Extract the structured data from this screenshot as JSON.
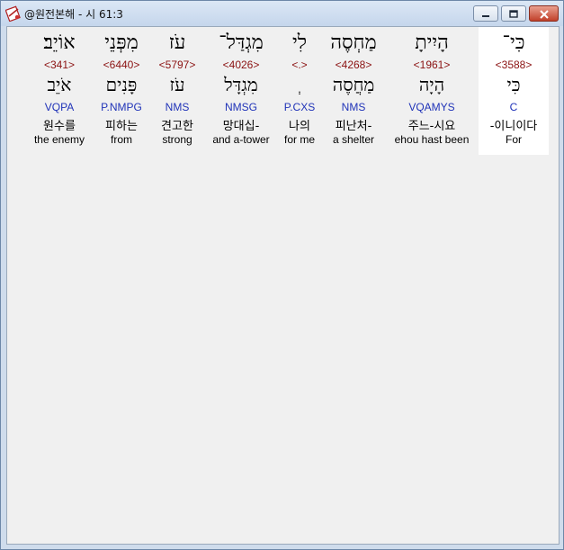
{
  "window": {
    "title": "@원전본해 - 시 61:3",
    "app_icon": "bible-book-icon",
    "controls": {
      "minimize": "minimize-icon",
      "maximize": "maximize-icon",
      "close": "close-icon"
    }
  },
  "words": [
    {
      "hebrew": "כִּי־",
      "strong": "<3588>",
      "lemma": "כִּי",
      "parse": "C",
      "korean": "-이니이다",
      "english": "For",
      "selected": true
    },
    {
      "hebrew": "הָיִיתָ",
      "strong": "<1961>",
      "lemma": "הָיָה",
      "parse": "VQAMYS",
      "korean": "주느-시요",
      "english": "ehou hast been",
      "selected": false
    },
    {
      "hebrew": "מַחְסֶה",
      "strong": "<4268>",
      "lemma": "מַחֲסֶה",
      "parse": "NMS",
      "korean": "피난처-",
      "english": "a shelter",
      "selected": false
    },
    {
      "hebrew": "לִי",
      "strong": "<.>",
      "lemma": "ְ",
      "parse": "P.CXS",
      "korean": "나의",
      "english": "for me",
      "selected": false
    },
    {
      "hebrew": "מִגְדַּל־",
      "strong": "<4026>",
      "lemma": "מִגְדָּל",
      "parse": "NMSG",
      "korean": "망대십-",
      "english": "and a-tower",
      "selected": false
    },
    {
      "hebrew": "עֹז",
      "strong": "<5797>",
      "lemma": "עֹז",
      "parse": "NMS",
      "korean": "견고한",
      "english": "strong",
      "selected": false
    },
    {
      "hebrew": "מִפְּנֵי",
      "strong": "<6440>",
      "lemma": "פָּנִים",
      "parse": "P.NMPG",
      "korean": "피하는",
      "english": "from",
      "selected": false
    },
    {
      "hebrew": "אוֹיֵב׃",
      "strong": "<341>",
      "lemma": "אֹיֵב",
      "parse": "VQPA",
      "korean": "원수를",
      "english": "the enemy",
      "selected": false
    }
  ]
}
